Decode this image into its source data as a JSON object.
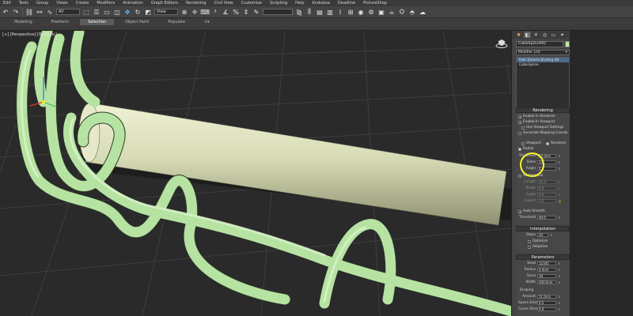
{
  "menu": [
    "Edit",
    "Tools",
    "Group",
    "Views",
    "Create",
    "Modifiers",
    "Animation",
    "Graph Editors",
    "Rendering",
    "Civil View",
    "Customize",
    "Scripting",
    "Help",
    "Krakatoa",
    "Deadline",
    "PictureShop"
  ],
  "toolbar": {
    "selection_filter": "All",
    "view_dropdown": "View"
  },
  "ribbon": {
    "tabs": [
      "Modeling",
      "Freeform",
      "Selection",
      "Object Paint",
      "Populate"
    ],
    "active": "Selection"
  },
  "viewport": {
    "label": "[+] [Perspective] [Realistic]"
  },
  "command_panel": {
    "object_name": "CableSpline002",
    "object_color": "#b8e8a6",
    "modifier_list": "Modifier List",
    "stack": [
      "Path Deform Binding (W",
      "CableSpline"
    ],
    "rendering": {
      "title": "Rendering",
      "enable_in_renderer": "Enable In Renderer",
      "enable_in_viewport": "Enable In Viewport",
      "use_viewport_settings": "Use Viewport Settings",
      "generate_mapping": "Generate Mapping Coords.",
      "viewport_label": "Viewport",
      "renderer_label": "Renderer",
      "radial": "Radial",
      "thickness_label": "Thickness",
      "thickness_value": "10.0cm",
      "sides_label": "Sides",
      "sides_value": "12",
      "angle_label": "Angle",
      "angle_value": "0.0",
      "rectangular": "Rectangular",
      "length_label": "Length",
      "length_value": "15.0",
      "width_label": "Width",
      "width_value": "6.0",
      "angle2_label": "Angle",
      "angle2_value": "0.0",
      "aspect_label": "Aspect",
      "aspect_value": "2.5",
      "auto_smooth": "Auto Smooth",
      "threshold_label": "Threshold",
      "threshold_value": "40.0"
    },
    "interpolation": {
      "title": "Interpolation",
      "steps_label": "Steps",
      "steps_value": "20",
      "optimize": "Optimize",
      "adaptive": "Adaptive"
    },
    "parameters": {
      "title": "Parameters",
      "seed_label": "Seed",
      "seed_value": "12345",
      "radius_label": "Radius",
      "radius_value": "4.0cm",
      "turns_label": "Turns",
      "turns_value": "10",
      "width_label": "Width",
      "width_value": "200.0cm",
      "draping_label": "Draping",
      "amount_label": "Amount",
      "amount_value": "11.0cm",
      "spacing_label": "Space Easing",
      "spacing_value": "0.5",
      "curve_label": "Curve Strength",
      "curve_value": "0.0"
    }
  }
}
